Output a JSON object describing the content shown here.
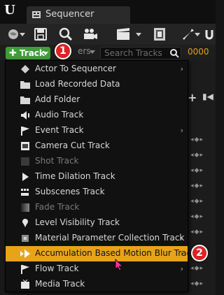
{
  "tab": {
    "title": "Sequencer"
  },
  "toolbar": {
    "track_button_label": "Track",
    "filters_label": "ers",
    "search_placeholder": "Search Tracks",
    "frame_value": "0000"
  },
  "menu": {
    "items": [
      {
        "label": "Actor To Sequencer",
        "icon": "actor-icon",
        "submenu": true,
        "disabled": false
      },
      {
        "label": "Load Recorded Data",
        "icon": "folder-icon",
        "submenu": false,
        "disabled": false
      },
      {
        "label": "Add Folder",
        "icon": "folder-icon",
        "submenu": false,
        "disabled": false
      },
      {
        "label": "Audio Track",
        "icon": "speaker-icon",
        "submenu": false,
        "disabled": false
      },
      {
        "label": "Event Track",
        "icon": "flag-icon",
        "submenu": true,
        "disabled": false
      },
      {
        "label": "Camera Cut Track",
        "icon": "camera-cut-icon",
        "submenu": false,
        "disabled": false
      },
      {
        "label": "Shot Track",
        "icon": "film-icon",
        "submenu": false,
        "disabled": true
      },
      {
        "label": "Time Dilation Track",
        "icon": "play-icon",
        "submenu": false,
        "disabled": false
      },
      {
        "label": "Subscenes Track",
        "icon": "subscene-icon",
        "submenu": false,
        "disabled": false
      },
      {
        "label": "Fade Track",
        "icon": "fade-icon",
        "submenu": false,
        "disabled": true
      },
      {
        "label": "Level Visibility Track",
        "icon": "pin-icon",
        "submenu": false,
        "disabled": false
      },
      {
        "label": "Material Parameter Collection Track",
        "icon": "material-icon",
        "submenu": true,
        "disabled": false
      },
      {
        "label": "Accumulation Based Motion Blur Track",
        "icon": "play-icon",
        "submenu": true,
        "disabled": false,
        "highlighted": true
      },
      {
        "label": "Flow Track",
        "icon": "flag-icon",
        "submenu": true,
        "disabled": false
      },
      {
        "label": "Media Track",
        "icon": "media-icon",
        "submenu": false,
        "disabled": false
      }
    ]
  },
  "annotations": {
    "badge_1": "1",
    "badge_2": "2"
  },
  "colors": {
    "highlight": "#e8a317",
    "track_button": "#3f9e3a",
    "badge": "#d92525",
    "frame": "#e0a21f"
  }
}
